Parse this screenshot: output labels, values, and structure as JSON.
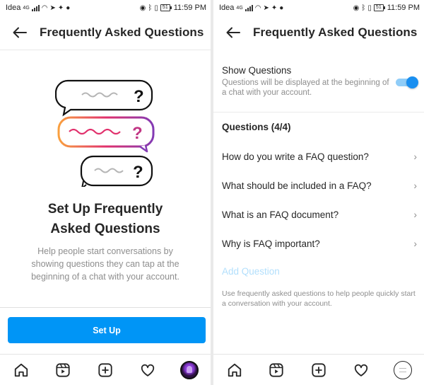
{
  "status_bar": {
    "carrier": "Idea",
    "network": "4G",
    "battery": "51",
    "time": "11:59 PM"
  },
  "intro_screen": {
    "title": "Frequently Asked Questions",
    "heading_line1": "Set Up Frequently",
    "heading_line2": "Asked Questions",
    "description": "Help people start conversations by showing questions they can tap at the beginning of a chat with your account.",
    "setup_button": "Set Up",
    "accent_gradient": [
      "#f9a03f",
      "#e1306c",
      "#833ab4"
    ]
  },
  "settings_screen": {
    "title": "Frequently Asked Questions",
    "toggle": {
      "title": "Show Questions",
      "subtitle": "Questions will be displayed at the beginning of a chat with your account.",
      "on": true
    },
    "questions_header": "Questions (4/4)",
    "questions": [
      "How do you write a FAQ question?",
      "What should be included in a FAQ?",
      "What is an FAQ document?",
      "Why is FAQ important?"
    ],
    "add_question": "Add Question",
    "footer_note": "Use frequently asked questions to help people quickly start a conversation with your account."
  },
  "tabs": [
    "home-icon",
    "reels-icon",
    "new-post-icon",
    "activity-heart-icon",
    "profile-avatar"
  ],
  "colors": {
    "primary_blue": "#0095f6",
    "disabled_blue": "#b2dffc",
    "toggle_on": "#1a8ff0"
  }
}
